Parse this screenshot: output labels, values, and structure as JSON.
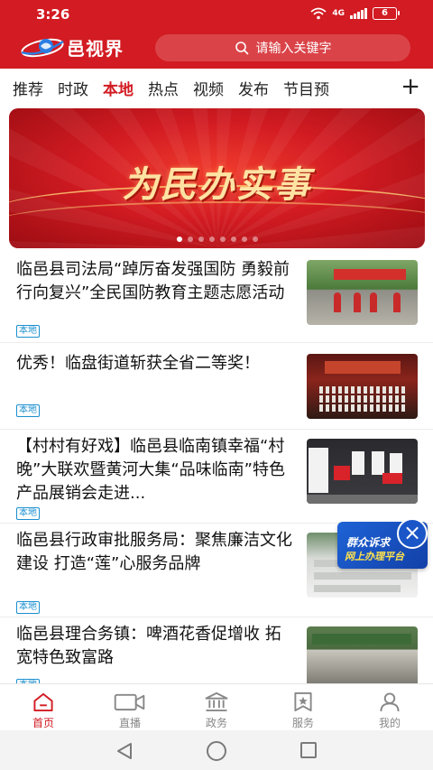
{
  "status_bar": {
    "time": "3:26",
    "network": "4G",
    "battery": "6"
  },
  "header": {
    "app_name": "邑视界",
    "search_placeholder": "请输入关键字"
  },
  "tabs": [
    {
      "label": "推荐",
      "active": false
    },
    {
      "label": "时政",
      "active": false
    },
    {
      "label": "本地",
      "active": true
    },
    {
      "label": "热点",
      "active": false
    },
    {
      "label": "视频",
      "active": false
    },
    {
      "label": "发布",
      "active": false
    },
    {
      "label": "节目预",
      "active": false
    }
  ],
  "banner": {
    "title": "为民办实事",
    "slide_count": 8,
    "active_slide": 1
  },
  "news": [
    {
      "title": "临邑县司法局“踔厉奋发强国防 勇毅前行向复兴”全民国防教育主题志愿活动",
      "tag": "本地"
    },
    {
      "title": "优秀！临盘街道斩获全省二等奖！",
      "tag": "本地"
    },
    {
      "title": "【村村有好戏】临邑县临南镇幸福“村晚”大联欢暨黄河大集“品味临南”特色产品展销会走进...",
      "tag": "本地"
    },
    {
      "title": "临邑县行政审批服务局：聚焦廉洁文化建设 打造“莲”心服务品牌",
      "tag": "本地"
    },
    {
      "title": "临邑县理合务镇：啤酒花香促增收 拓宽特色致富路",
      "tag": "本地"
    }
  ],
  "float_ad": {
    "line1": "群众诉求",
    "line2": "网上办理平台"
  },
  "bottom_nav": [
    {
      "label": "首页",
      "icon": "home-icon",
      "active": true
    },
    {
      "label": "直播",
      "icon": "video-camera-icon",
      "active": false
    },
    {
      "label": "政务",
      "icon": "government-building-icon",
      "active": false
    },
    {
      "label": "服务",
      "icon": "star-badge-icon",
      "active": false
    },
    {
      "label": "我的",
      "icon": "user-icon",
      "active": false
    }
  ],
  "colors": {
    "brand": "#d21b22",
    "tag": "#1a8fd0",
    "float_ad": "#1a56c8"
  }
}
